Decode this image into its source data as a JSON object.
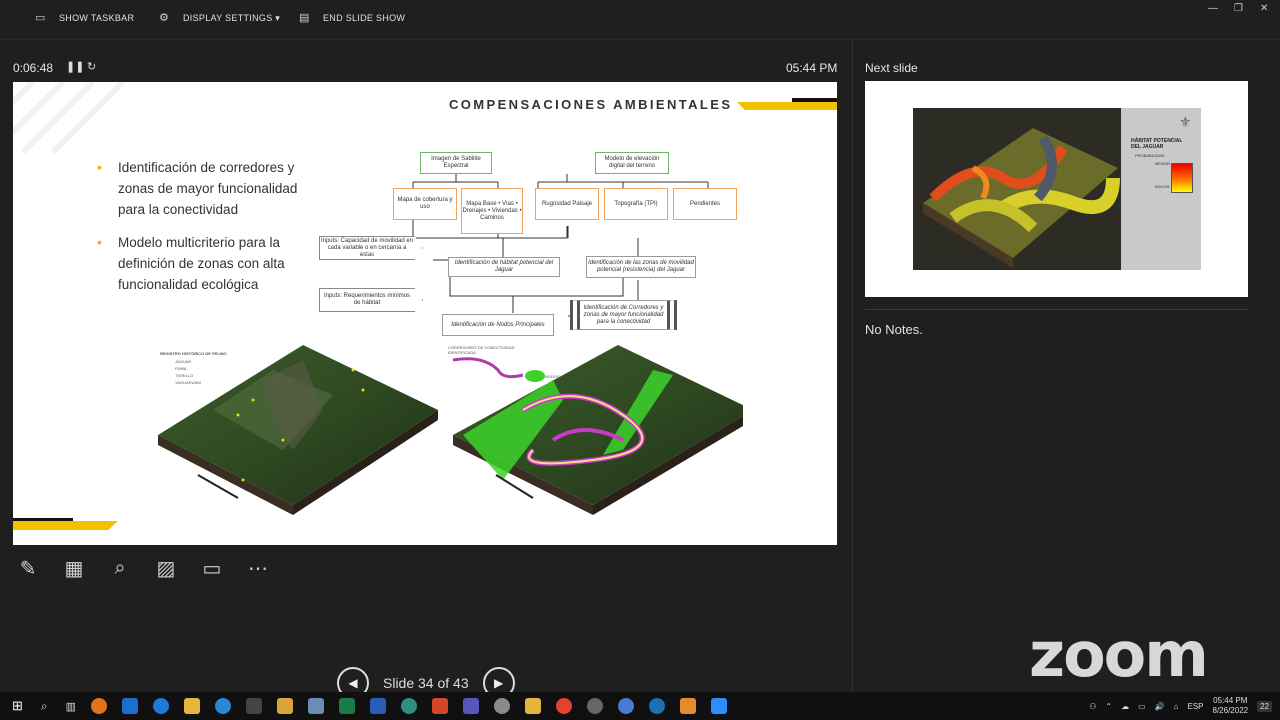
{
  "toolbar": {
    "show_taskbar": "SHOW TASKBAR",
    "display_settings": "DISPLAY SETTINGS ▾",
    "end_slide_show": "END SLIDE SHOW"
  },
  "presenter": {
    "elapsed": "0:06:48",
    "clock": "05:44 PM",
    "next_slide_label": "Next slide",
    "notes": "No Notes.",
    "slide_counter": "Slide 34 of 43"
  },
  "slide": {
    "title": "COMPENSACIONES AMBIENTALES",
    "bullets": [
      "Identificación de corredores y zonas de mayor funcionalidad para la conectividad",
      "Modelo multicriterio para la definición de zonas con alta funcionalidad ecológica"
    ],
    "diagram": {
      "imagen_sabilite": "Imagen de Sabilite Espectral",
      "modelo_elevacion": "Modelo de elevación digital del terreno",
      "mapa_cobertura": "Mapa de cobertura y uso",
      "mapa_base": "Mapa Base • Vías • Drenajes • Viviendas • Caminos",
      "rugosidad": "Rugosidad Paisaje",
      "topografia": "Topografía (TPI)",
      "pendientes": "Pendientes",
      "inputs1": "Inputs: Capacidad de movilidad en cada variable o en cercanía a estas",
      "habitat_potencial": "Identificación de hábitat potencial del Jaguar",
      "zonas_movilidad": "Identificación de las zonas de movilidad potencial (resistencia) del Jaguar",
      "inputs2": "Inputs: Requerimientos mínimos de hábitat",
      "corredores": "Identificación de Corredores y zonas de mayor funcionalidad para la conectividad",
      "nodos": "Identificación de Nodos Principales"
    },
    "map_left_legend": [
      "REGISTRO HISTÓRICO DE FELINO",
      "JAGUAR",
      "PUMA",
      "TIGRILLO",
      "YAGUARUNDÍ"
    ],
    "map_right_legend": [
      "CORREDORES DE CONECTIVIDAD",
      "IDENTIFICADA"
    ],
    "map_right_tag": "NODOS"
  },
  "next_slide": {
    "title": "HÁBITAT POTENCIAL DEL JAGUAR",
    "subtitle": "PROBABILIDAD",
    "low": "MENOR",
    "high": "MAYOR"
  },
  "zoom_logo": "zoom",
  "tray": {
    "lang": "ESP",
    "time": "05:44 PM",
    "date": "8/26/2022",
    "notif": "22"
  },
  "colors": {
    "accent_yellow": "#f2c200",
    "background": "#1f1f1f"
  }
}
